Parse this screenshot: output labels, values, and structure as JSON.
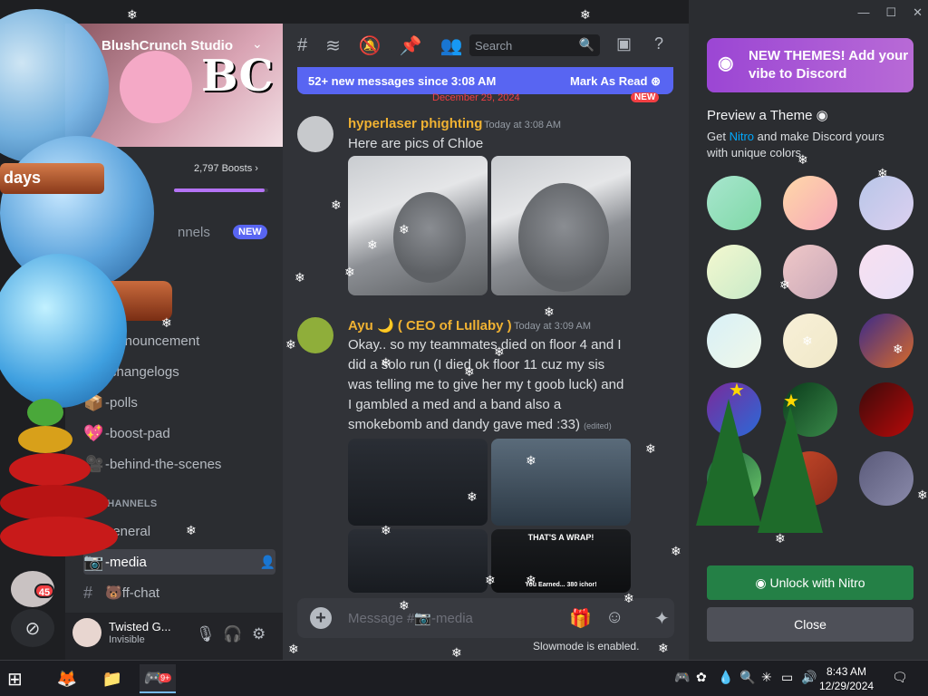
{
  "server": {
    "name": "BlushCrunch Studio",
    "boosts": "2,797 Boosts",
    "boost_progress": 0.96,
    "countdown_label": "days"
  },
  "sidebar": {
    "channels_label": "nnels",
    "channels_badge": "NEW",
    "channels": [
      {
        "name": "-announcement",
        "icon": ""
      },
      {
        "name": "-changelogs",
        "icon": ""
      },
      {
        "name": "-polls",
        "icon": "📦"
      },
      {
        "name": "-boost-pad",
        "icon": "💖"
      },
      {
        "name": "-behind-the-scenes",
        "icon": "🎥"
      }
    ],
    "category": "CHANNELS",
    "text_channels": [
      {
        "name": "general",
        "icon": "",
        "active": false
      },
      {
        "name": "-media",
        "icon": "📷",
        "active": true
      },
      {
        "name": "ff-chat",
        "icon": "🐻",
        "active": false
      }
    ]
  },
  "rail": {
    "mention_badge": "45"
  },
  "user": {
    "name": "Twisted G...",
    "status": "Invisible"
  },
  "topbar": {
    "search_placeholder": "Search"
  },
  "new_messages": {
    "text": "52+ new messages since 3:08 AM",
    "action": "Mark As Read"
  },
  "date_separator": "December 29, 2024",
  "date_new": "NEW",
  "messages": [
    {
      "author": "hyperlaser phighting",
      "author_color": "#f0b232",
      "time": "Today at 3:08 AM",
      "text": "Here are pics of Chloe"
    },
    {
      "author": "Ayu",
      "author_tag": "( CEO of Lullaby )",
      "author_color": "#f0b232",
      "time": "Today at 3:09 AM",
      "text": "Okay.. so my teammates died on floor 4 and I did a solo run (I died ok floor 11 cuz my sis was telling me to give her my t goob luck) and I gambled a med and a band also a smokebomb and dandy gave med :33)",
      "edited": "(edited)",
      "screenshot_caption": "THAT'S A WRAP!",
      "screenshot_earned": "You Earned... 380 ichor!"
    }
  ],
  "composer": {
    "placeholder": "Message #📷-media",
    "slowmode": "Slowmode is enabled."
  },
  "nitro_panel": {
    "themes_button": "NEW THEMES! Add your vibe to Discord",
    "preview_title": "Preview a Theme",
    "preview_desc_link": "Nitro",
    "preview_desc_pre": "Get ",
    "preview_desc_post": " and make Discord yours with unique colors",
    "unlock_label": "Unlock with Nitro",
    "close_label": "Close",
    "swatches": [
      "linear-gradient(135deg,#a8e6cf,#7fd8a6)",
      "linear-gradient(135deg,#ffd8a8,#f6a8b8)",
      "linear-gradient(135deg,#b8c6e8,#dcd0f0)",
      "linear-gradient(135deg,#f4f8d0,#c8eac8)",
      "linear-gradient(135deg,#f0c8c8,#c8a8b8)",
      "linear-gradient(135deg,#f8e0f0,#e8e0f8)",
      "linear-gradient(135deg,#d8f0f8,#f0f8e8)",
      "linear-gradient(135deg,#f8f0d8,#f0e8c8)",
      "linear-gradient(135deg,#3a2a8a,#d86a2a)",
      "linear-gradient(135deg,#7a2a9a,#2a6ad8)",
      "linear-gradient(135deg,#0a3a1a,#3a8a4a)",
      "linear-gradient(135deg,#3a0a0a,#b80a0a)",
      "linear-gradient(135deg,#1a5a3a,#6ac86a)",
      "linear-gradient(135deg,#c84a2a,#8a2a1a)",
      "linear-gradient(135deg,#5a5a7a,#8a8aaa)",
      "linear-gradient(135deg,#3a7a6a,#2a4a5a)",
      "linear-gradient(135deg,#2a4a8a,#4a6aaa)",
      "linear-gradient(135deg,#1a8aaa,#5a3aaa)"
    ]
  },
  "taskbar": {
    "time": "8:43 AM",
    "date": "12/29/2024",
    "discord_badge": "9+"
  }
}
